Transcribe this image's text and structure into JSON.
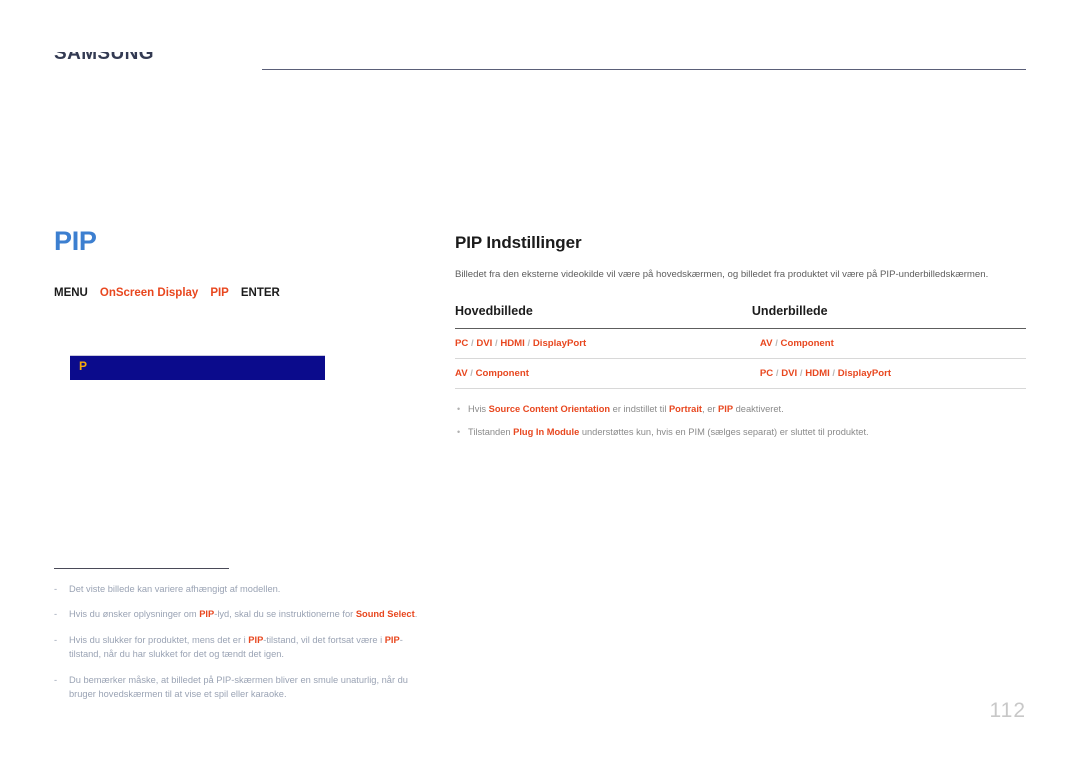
{
  "header": {
    "running_head": "SAMSUNG",
    "rule_color": "#5a5f78"
  },
  "left": {
    "section_title": "PIP",
    "breadcrumb": [
      {
        "label": "MENU",
        "highlight": false
      },
      {
        "label": "OnScreen Display",
        "highlight": true
      },
      {
        "label": "PIP",
        "highlight": true
      },
      {
        "label": "ENTER",
        "highlight": false
      }
    ],
    "osd_screenshot": {
      "label": "P",
      "background": "#0b0b8c",
      "label_color": "#f5a90b"
    },
    "footnotes": [
      {
        "dash": "-",
        "parts": [
          {
            "t": "Det viste billede kan variere afhængigt af modellen.",
            "b": false
          }
        ]
      },
      {
        "dash": "-",
        "parts": [
          {
            "t": "Hvis du ønsker oplysninger om ",
            "b": false
          },
          {
            "t": "PIP",
            "b": true
          },
          {
            "t": "-lyd, skal du se instruktionerne for ",
            "b": false
          },
          {
            "t": "Sound Select",
            "b": true
          },
          {
            "t": ".",
            "b": false
          }
        ]
      },
      {
        "dash": "-",
        "parts": [
          {
            "t": "Hvis du slukker for produktet, mens det er i ",
            "b": false
          },
          {
            "t": "PIP",
            "b": true
          },
          {
            "t": "-tilstand, vil det fortsat være i ",
            "b": false
          },
          {
            "t": "PIP",
            "b": true
          },
          {
            "t": "-tilstand, når du har slukket for det og tændt det igen.",
            "b": false
          }
        ]
      },
      {
        "dash": "-",
        "parts": [
          {
            "t": "Du bemærker måske, at billedet på PIP-skærmen bliver en smule unaturlig, når du bruger hovedskærmen til at vise et spil eller karaoke.",
            "b": false
          }
        ]
      }
    ]
  },
  "right": {
    "sub_title": "PIP Indstillinger",
    "lead": "Billedet fra den eksterne videokilde vil være på hovedskærmen, og billedet fra produktet vil være på PIP-underbilledskærmen.",
    "table": {
      "columns": [
        "Hovedbillede",
        "Underbillede"
      ],
      "rows": [
        {
          "main": [
            "PC",
            "DVI",
            "HDMI",
            "DisplayPort"
          ],
          "sub": [
            "AV",
            "Component"
          ]
        },
        {
          "main": [
            "AV",
            "Component"
          ],
          "sub": [
            "PC",
            "DVI",
            "HDMI",
            "DisplayPort"
          ]
        }
      ]
    },
    "notes": [
      {
        "bullet": "•",
        "parts": [
          {
            "t": "Hvis ",
            "b": false
          },
          {
            "t": "Source Content Orientation",
            "b": true
          },
          {
            "t": " er indstillet til ",
            "b": false
          },
          {
            "t": "Portrait",
            "b": true
          },
          {
            "t": ", er ",
            "b": false
          },
          {
            "t": "PIP",
            "b": true
          },
          {
            "t": " deaktiveret.",
            "b": false
          }
        ]
      },
      {
        "bullet": "•",
        "parts": [
          {
            "t": "Tilstanden ",
            "b": false
          },
          {
            "t": "Plug In Module",
            "b": true
          },
          {
            "t": " understøttes kun, hvis en PIM (sælges separat) er sluttet til produktet.",
            "b": false
          }
        ]
      }
    ]
  },
  "page_number": "112",
  "colors": {
    "accent_blue": "#3c7fd0",
    "accent_orange": "#e8471f",
    "header_navy": "#333a52",
    "osd_blue": "#0b0b8c",
    "osd_amber": "#f5a90b",
    "page_number_gray": "#c8c8c8"
  }
}
